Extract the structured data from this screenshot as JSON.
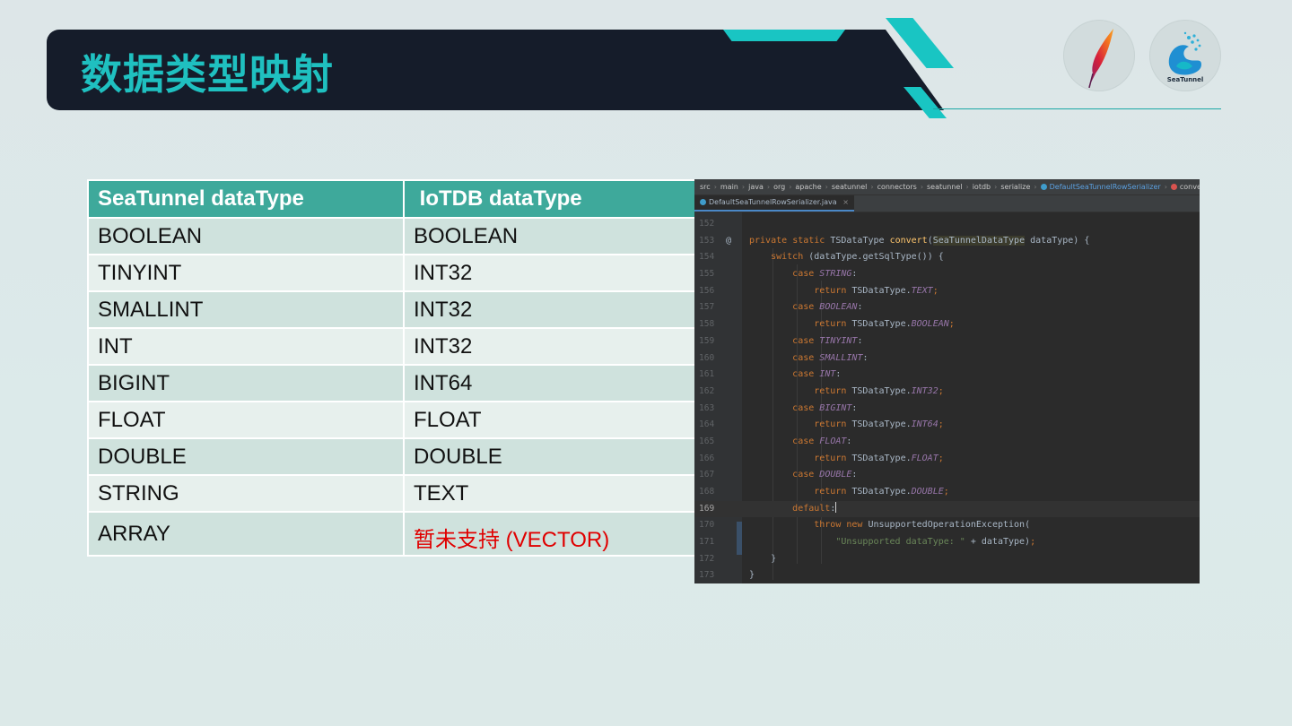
{
  "header": {
    "title": "数据类型映射",
    "logos": [
      {
        "name": "apache-feather-logo"
      },
      {
        "name": "seatunnel-logo",
        "label": "SeaTunnel"
      }
    ],
    "accent_color": "#19c5c3",
    "banner_color": "#151c2a"
  },
  "table": {
    "headers": [
      "SeaTunnel dataType",
      " IoTDB dataType"
    ],
    "rows": [
      [
        "BOOLEAN",
        "BOOLEAN"
      ],
      [
        "TINYINT",
        "INT32"
      ],
      [
        "SMALLINT",
        "INT32"
      ],
      [
        "INT",
        "INT32"
      ],
      [
        "BIGINT",
        "INT64"
      ],
      [
        "FLOAT",
        "FLOAT"
      ],
      [
        "DOUBLE",
        "DOUBLE"
      ],
      [
        "STRING",
        "TEXT"
      ],
      [
        "ARRAY",
        "暂未支持 (VECTOR)"
      ]
    ],
    "header_color": "#3ea99b",
    "unsupported_color": "#e00000"
  },
  "ide": {
    "breadcrumb": [
      "src",
      "main",
      "java",
      "org",
      "apache",
      "seatunnel",
      "connectors",
      "seatunnel",
      "iotdb",
      "serialize",
      "DefaultSeaTunnelRowSerializer",
      "convert"
    ],
    "tab": "DefaultSeaTunnelRowSerializer.java",
    "tab_close": "×",
    "current_line": "169",
    "lines": [
      {
        "n": "152",
        "mk": "",
        "t": ""
      },
      {
        "n": "153",
        "mk": "@",
        "t": "    private static TSDataType convert(SeaTunnelDataType dataType) {"
      },
      {
        "n": "154",
        "mk": "",
        "t": "        switch (dataType.getSqlType()) {"
      },
      {
        "n": "155",
        "mk": "",
        "t": "            case STRING:"
      },
      {
        "n": "156",
        "mk": "",
        "t": "                return TSDataType.TEXT;"
      },
      {
        "n": "157",
        "mk": "",
        "t": "            case BOOLEAN:"
      },
      {
        "n": "158",
        "mk": "",
        "t": "                return TSDataType.BOOLEAN;"
      },
      {
        "n": "159",
        "mk": "",
        "t": "            case TINYINT:"
      },
      {
        "n": "160",
        "mk": "",
        "t": "            case SMALLINT:"
      },
      {
        "n": "161",
        "mk": "",
        "t": "            case INT:"
      },
      {
        "n": "162",
        "mk": "",
        "t": "                return TSDataType.INT32;"
      },
      {
        "n": "163",
        "mk": "",
        "t": "            case BIGINT:"
      },
      {
        "n": "164",
        "mk": "",
        "t": "                return TSDataType.INT64;"
      },
      {
        "n": "165",
        "mk": "",
        "t": "            case FLOAT:"
      },
      {
        "n": "166",
        "mk": "",
        "t": "                return TSDataType.FLOAT;"
      },
      {
        "n": "167",
        "mk": "",
        "t": "            case DOUBLE:"
      },
      {
        "n": "168",
        "mk": "",
        "t": "                return TSDataType.DOUBLE;"
      },
      {
        "n": "169",
        "mk": "",
        "t": "            default:"
      },
      {
        "n": "170",
        "mk": "",
        "t": "                throw new UnsupportedOperationException("
      },
      {
        "n": "171",
        "mk": "",
        "t": "                    \"Unsupported dataType: \" + dataType);"
      },
      {
        "n": "172",
        "mk": "",
        "t": "        }"
      },
      {
        "n": "173",
        "mk": "",
        "t": "    }"
      }
    ]
  }
}
